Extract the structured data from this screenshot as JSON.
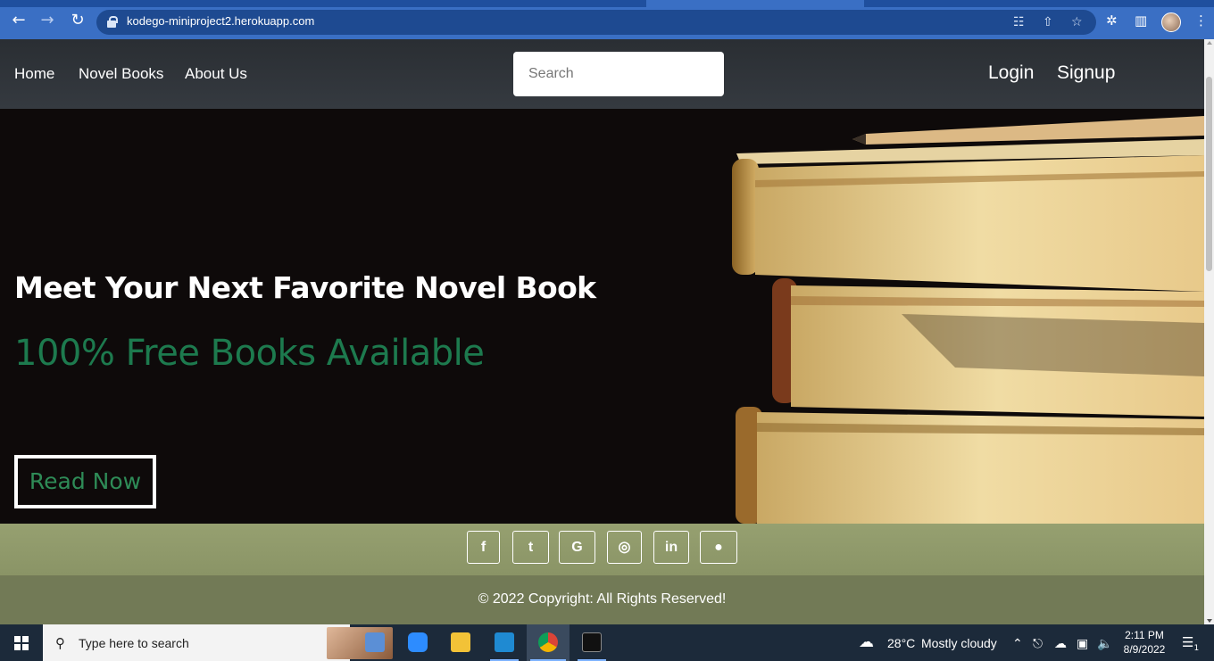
{
  "browser": {
    "url": "kodego-miniproject2.herokuapp.com",
    "back_icon": "←",
    "forward_icon": "→",
    "reload_icon": "↻",
    "translate_icon": "☷",
    "share_icon": "⇧",
    "star_icon": "☆",
    "extensions_icon": "✲",
    "sidepanel_icon": "▥",
    "menu_icon": "⋮"
  },
  "nav": {
    "links": [
      "Home",
      "Novel Books",
      "About Us"
    ],
    "search_placeholder": "Search",
    "login": "Login",
    "signup": "Signup"
  },
  "hero": {
    "title": "Meet Your Next Favorite Novel Book",
    "subtitle": "100% Free Books Available",
    "cta": "Read Now"
  },
  "social": [
    {
      "name": "facebook",
      "glyph": "f"
    },
    {
      "name": "twitter",
      "glyph": "t"
    },
    {
      "name": "google",
      "glyph": "G"
    },
    {
      "name": "instagram",
      "glyph": "◎"
    },
    {
      "name": "linkedin",
      "glyph": "in"
    },
    {
      "name": "github",
      "glyph": "●"
    }
  ],
  "footer": {
    "copyright": "© 2022 Copyright: All Rights Reserved!"
  },
  "taskbar": {
    "search_placeholder": "Type here to search",
    "weather_temp": "28°C",
    "weather_desc": "Mostly cloudy",
    "time": "2:11 PM",
    "date": "8/9/2022",
    "notification_count": "1"
  },
  "colors": {
    "accent_green": "#1d7a4e",
    "social_bar": "#8a9466",
    "footer": "#727a56",
    "browser_chrome": "#3a6fc4"
  }
}
